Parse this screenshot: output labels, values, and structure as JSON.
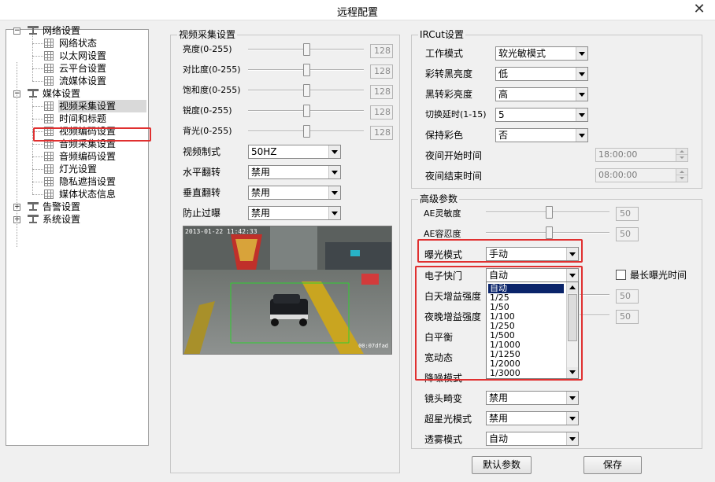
{
  "window": {
    "title": "远程配置"
  },
  "tree": {
    "items": [
      {
        "label": "网络设置",
        "level": 0,
        "expander": "−"
      },
      {
        "label": "网络状态",
        "level": 1
      },
      {
        "label": "以太网设置",
        "level": 1
      },
      {
        "label": "云平台设置",
        "level": 1
      },
      {
        "label": "流媒体设置",
        "level": 1
      },
      {
        "label": "媒体设置",
        "level": 0,
        "expander": "−"
      },
      {
        "label": "视频采集设置",
        "level": 1,
        "selected": true
      },
      {
        "label": "时间和标题",
        "level": 1
      },
      {
        "label": "视频编码设置",
        "level": 1
      },
      {
        "label": "音频采集设置",
        "level": 1
      },
      {
        "label": "音频编码设置",
        "level": 1
      },
      {
        "label": "灯光设置",
        "level": 1
      },
      {
        "label": "隐私遮挡设置",
        "level": 1
      },
      {
        "label": "媒体状态信息",
        "level": 1
      },
      {
        "label": "告警设置",
        "level": 0,
        "expander": "+"
      },
      {
        "label": "系统设置",
        "level": 0,
        "expander": "+"
      }
    ]
  },
  "video_capture": {
    "title": "视频采集设置",
    "sliders": [
      {
        "label": "亮度(0-255)",
        "value": "128"
      },
      {
        "label": "对比度(0-255)",
        "value": "128"
      },
      {
        "label": "饱和度(0-255)",
        "value": "128"
      },
      {
        "label": "锐度(0-255)",
        "value": "128"
      },
      {
        "label": "背光(0-255)",
        "value": "128"
      }
    ],
    "selects": [
      {
        "label": "视频制式",
        "value": "50HZ"
      },
      {
        "label": "水平翻转",
        "value": "禁用"
      },
      {
        "label": "垂直翻转",
        "value": "禁用"
      },
      {
        "label": "防止过曝",
        "value": "禁用"
      }
    ],
    "preview": {
      "timestamp": "2013-01-22  11:42:33",
      "corner": "00:07dfad"
    }
  },
  "ircut": {
    "title": "IRCut设置",
    "rows": [
      {
        "label": "工作模式",
        "value": "软光敏模式"
      },
      {
        "label": "彩转黑亮度",
        "value": "低"
      },
      {
        "label": "黑转彩亮度",
        "value": "高"
      },
      {
        "label": "切换延时(1-15)",
        "value": "5"
      },
      {
        "label": "保持彩色",
        "value": "否"
      }
    ],
    "night_start": {
      "label": "夜间开始时间",
      "value": "18:00:00"
    },
    "night_end": {
      "label": "夜间结束时间",
      "value": "08:00:00"
    }
  },
  "advanced": {
    "title": "高级参数",
    "ae_sensitivity": {
      "label": "AE灵敏度",
      "value": "50"
    },
    "ae_tolerance": {
      "label": "AE容忍度",
      "value": "50"
    },
    "exposure_mode": {
      "label": "曝光模式",
      "value": "手动"
    },
    "shutter": {
      "label": "电子快门",
      "value": "自动"
    },
    "max_exposure": {
      "label": "最长曝光时间"
    },
    "day_gain": {
      "label": "白天增益强度",
      "value": "50"
    },
    "night_gain": {
      "label": "夜晚增益强度",
      "value": "50"
    },
    "white_balance": {
      "label": "白平衡"
    },
    "wdr": {
      "label": "宽动态"
    },
    "denoise": {
      "label": "降噪模式"
    },
    "lens_distortion": {
      "label": "镜头畸变",
      "value": "禁用"
    },
    "starlight": {
      "label": "超星光模式",
      "value": "禁用"
    },
    "defog": {
      "label": "透雾模式",
      "value": "自动"
    },
    "shutter_options": [
      "自动",
      "1/25",
      "1/50",
      "1/100",
      "1/250",
      "1/500",
      "1/1000",
      "1/1250",
      "1/2000",
      "1/3000"
    ]
  },
  "buttons": {
    "defaults": "默认参数",
    "save": "保存"
  }
}
